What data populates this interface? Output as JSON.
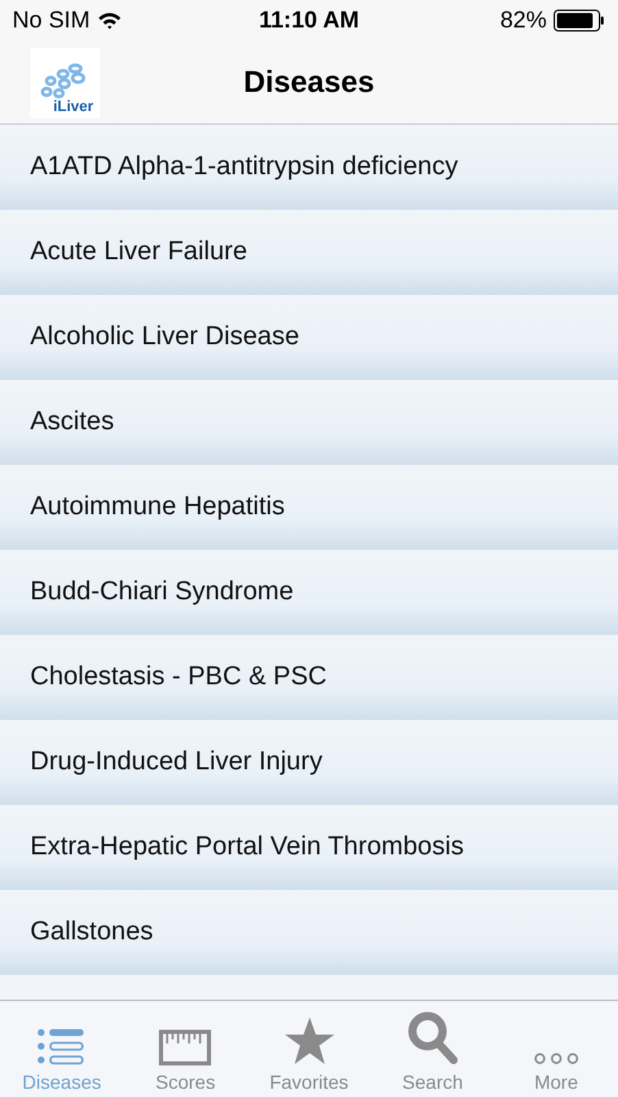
{
  "status_bar": {
    "carrier": "No SIM",
    "time": "11:10 AM",
    "battery": "82%"
  },
  "nav_bar": {
    "logo_text": "iLiver",
    "title": "Diseases"
  },
  "diseases": [
    "A1ATD Alpha-1-antitrypsin deficiency",
    "Acute Liver Failure",
    "Alcoholic Liver Disease",
    "Ascites",
    "Autoimmune Hepatitis",
    "Budd-Chiari Syndrome",
    "Cholestasis - PBC & PSC",
    "Drug-Induced Liver Injury",
    "Extra-Hepatic Portal Vein Thrombosis",
    "Gallstones"
  ],
  "tabs": [
    {
      "kind": "list",
      "label": "Diseases",
      "selected": true
    },
    {
      "kind": "ruler",
      "label": "Scores",
      "selected": false
    },
    {
      "kind": "star",
      "label": "Favorites",
      "selected": false
    },
    {
      "kind": "search",
      "label": "Search",
      "selected": false
    },
    {
      "kind": "more",
      "label": "More",
      "selected": false
    }
  ]
}
